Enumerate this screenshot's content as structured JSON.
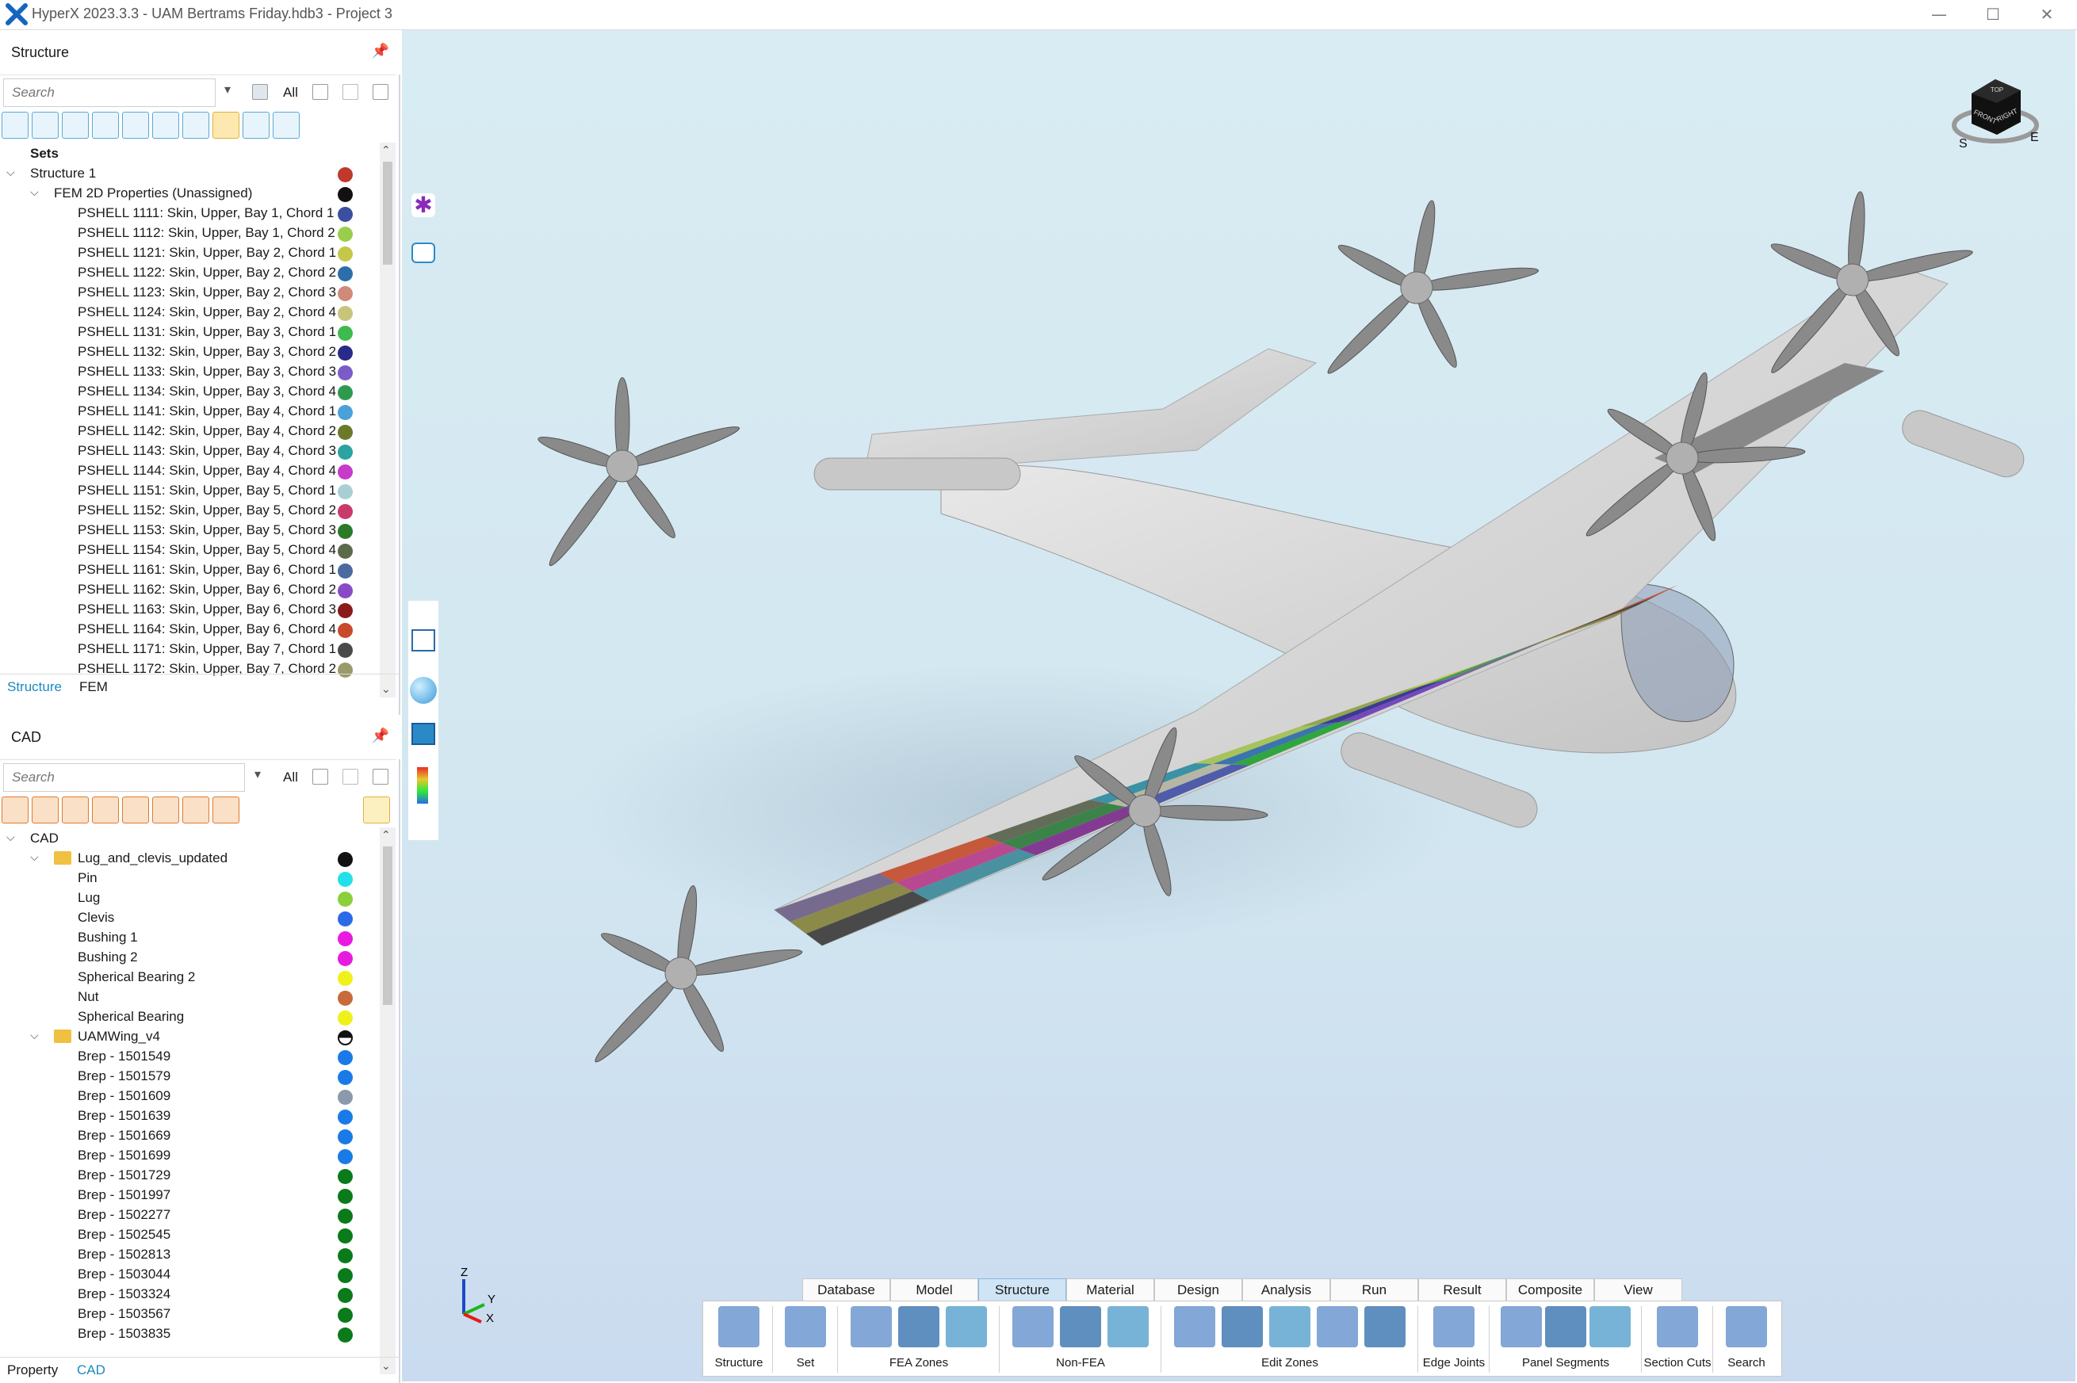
{
  "window": {
    "title": "HyperX 2023.3.3 - UAM Bertrams Friday.hdb3 - Project 3",
    "minimize": "—",
    "maximize": "☐",
    "close": "✕"
  },
  "structure_panel": {
    "title": "Structure",
    "search_placeholder": "Search",
    "filter_all": "All",
    "sets_label": "Sets",
    "root": {
      "label": "Structure 1",
      "color": "#c0392b"
    },
    "group": {
      "label": "FEM 2D Properties (Unassigned)",
      "color": "#111111"
    },
    "items": [
      {
        "label": "PSHELL 1111: Skin, Upper, Bay 1, Chord 1",
        "color": "#3b4fa0"
      },
      {
        "label": "PSHELL 1112: Skin, Upper, Bay 1, Chord 2",
        "color": "#9acd4a"
      },
      {
        "label": "PSHELL 1121: Skin, Upper, Bay 2, Chord 1",
        "color": "#c4c84a"
      },
      {
        "label": "PSHELL 1122: Skin, Upper, Bay 2, Chord 2",
        "color": "#2b6fa8"
      },
      {
        "label": "PSHELL 1123: Skin, Upper, Bay 2, Chord 3",
        "color": "#d08a7a"
      },
      {
        "label": "PSHELL 1124: Skin, Upper, Bay 2, Chord 4",
        "color": "#c8c47a"
      },
      {
        "label": "PSHELL 1131: Skin, Upper, Bay 3, Chord 1",
        "color": "#3dbb4f"
      },
      {
        "label": "PSHELL 1132: Skin, Upper, Bay 3, Chord 2",
        "color": "#2a2a8a"
      },
      {
        "label": "PSHELL 1133: Skin, Upper, Bay 3, Chord 3",
        "color": "#7a5cc8"
      },
      {
        "label": "PSHELL 1134: Skin, Upper, Bay 3, Chord 4",
        "color": "#2f9a4f"
      },
      {
        "label": "PSHELL 1141: Skin, Upper, Bay 4, Chord 1",
        "color": "#4aa0d8"
      },
      {
        "label": "PSHELL 1142: Skin, Upper, Bay 4, Chord 2",
        "color": "#6b7a2a"
      },
      {
        "label": "PSHELL 1143: Skin, Upper, Bay 4, Chord 3",
        "color": "#2ba3a0"
      },
      {
        "label": "PSHELL 1144: Skin, Upper, Bay 4, Chord 4",
        "color": "#c83ac8"
      },
      {
        "label": "PSHELL 1151: Skin, Upper, Bay 5, Chord 1",
        "color": "#a8d0d4"
      },
      {
        "label": "PSHELL 1152: Skin, Upper, Bay 5, Chord 2",
        "color": "#c83a6a"
      },
      {
        "label": "PSHELL 1153: Skin, Upper, Bay 5, Chord 3",
        "color": "#2a7a2a"
      },
      {
        "label": "PSHELL 1154: Skin, Upper, Bay 5, Chord 4",
        "color": "#5a6a4a"
      },
      {
        "label": "PSHELL 1161: Skin, Upper, Bay 6, Chord 1",
        "color": "#4a6aa0"
      },
      {
        "label": "PSHELL 1162: Skin, Upper, Bay 6, Chord 2",
        "color": "#8a4ac8"
      },
      {
        "label": "PSHELL 1163: Skin, Upper, Bay 6, Chord 3",
        "color": "#8a1a1a"
      },
      {
        "label": "PSHELL 1164: Skin, Upper, Bay 6, Chord 4",
        "color": "#c84a2a"
      },
      {
        "label": "PSHELL 1171: Skin, Upper, Bay 7, Chord 1",
        "color": "#4a4a4a"
      },
      {
        "label": "PSHELL 1172: Skin, Upper, Bay 7, Chord 2",
        "color": "#9a9a6a"
      }
    ],
    "tabs": [
      "Structure",
      "FEM"
    ]
  },
  "cad_panel": {
    "title": "CAD",
    "search_placeholder": "Search",
    "filter_all": "All",
    "root": {
      "label": "CAD"
    },
    "folder1": {
      "label": "Lug_and_clevis_updated",
      "color": "#111111"
    },
    "folder1_items": [
      {
        "label": "Pin",
        "color": "#22e0e8"
      },
      {
        "label": "Lug",
        "color": "#8ad03a"
      },
      {
        "label": "Clevis",
        "color": "#2a6ae8"
      },
      {
        "label": "Bushing 1",
        "color": "#e81ae0"
      },
      {
        "label": "Bushing 2",
        "color": "#e81ae0"
      },
      {
        "label": "Spherical Bearing 2",
        "color": "#f0f01a"
      },
      {
        "label": "Nut",
        "color": "#c86a3a"
      },
      {
        "label": "Spherical Bearing",
        "color": "#f0f01a"
      }
    ],
    "folder2": {
      "label": "UAMWing_v4",
      "color": "#111111"
    },
    "folder2_items": [
      {
        "label": "Brep - 1501549",
        "color": "#1a7ae8"
      },
      {
        "label": "Brep - 1501579",
        "color": "#1a7ae8"
      },
      {
        "label": "Brep - 1501609",
        "color": "#8a9aaa"
      },
      {
        "label": "Brep - 1501639",
        "color": "#1a7ae8"
      },
      {
        "label": "Brep - 1501669",
        "color": "#1a7ae8"
      },
      {
        "label": "Brep - 1501699",
        "color": "#1a7ae8"
      },
      {
        "label": "Brep - 1501729",
        "color": "#0a7a1a"
      },
      {
        "label": "Brep - 1501997",
        "color": "#0a7a1a"
      },
      {
        "label": "Brep - 1502277",
        "color": "#0a7a1a"
      },
      {
        "label": "Brep - 1502545",
        "color": "#0a7a1a"
      },
      {
        "label": "Brep - 1502813",
        "color": "#0a7a1a"
      },
      {
        "label": "Brep - 1503044",
        "color": "#0a7a1a"
      },
      {
        "label": "Brep - 1503324",
        "color": "#0a7a1a"
      },
      {
        "label": "Brep - 1503567",
        "color": "#0a7a1a"
      },
      {
        "label": "Brep - 1503835",
        "color": "#0a7a1a"
      }
    ],
    "tabs": [
      "Property",
      "CAD"
    ]
  },
  "viewcube": {
    "top": "TOP",
    "front": "FRONT",
    "right": "RIGHT",
    "compass_s": "S",
    "compass_e": "E"
  },
  "axes": {
    "z": "Z",
    "y": "Y",
    "x": "X"
  },
  "ribbon": {
    "tabs": [
      "Database",
      "Model",
      "Structure",
      "Material",
      "Design",
      "Analysis",
      "Run",
      "Result",
      "Composite",
      "View"
    ],
    "active_tab": "Structure",
    "groups": [
      "Structure",
      "Set",
      "FEA Zones",
      "Non-FEA",
      "Edit Zones",
      "Edge Joints",
      "Panel Segments",
      "Section Cuts",
      "Search"
    ]
  },
  "wing_colors": [
    "#6b5f86",
    "#84823a",
    "#3a3a3a",
    "#c44a2a",
    "#b53a8a",
    "#3a8a9a",
    "#56604a",
    "#2a7a3a",
    "#7a2a8a",
    "#2a8aa0",
    "#b2b2a0",
    "#3f4fa5",
    "#a3c050",
    "#2a6aa8",
    "#1fa02f",
    "#8aa040",
    "#2a2a8a",
    "#6a3ab8",
    "#c8c04a",
    "#2a9a3a"
  ]
}
